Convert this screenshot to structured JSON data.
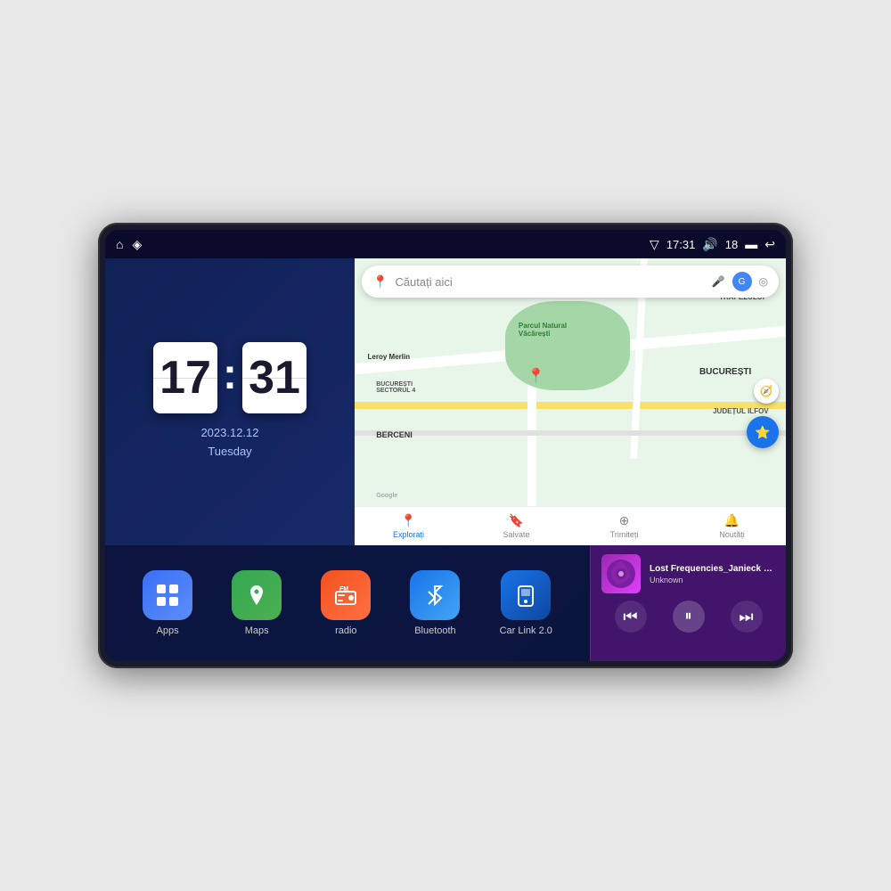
{
  "device": {
    "status_bar": {
      "signal_icon": "▽",
      "time": "17:31",
      "volume_icon": "🔊",
      "battery_level": "18",
      "battery_icon": "▬",
      "back_icon": "↩",
      "home_icon": "⌂",
      "nav_icon": "◈"
    },
    "clock": {
      "hours": "17",
      "minutes": "31",
      "date": "2023.12.12",
      "day": "Tuesday"
    },
    "map": {
      "search_placeholder": "Căutați aici",
      "nav_items": [
        {
          "label": "Explorați",
          "icon": "📍",
          "active": true
        },
        {
          "label": "Salvate",
          "icon": "🔖",
          "active": false
        },
        {
          "label": "Trimiteți",
          "icon": "⊕",
          "active": false
        },
        {
          "label": "Noutăți",
          "icon": "🔔",
          "active": false
        }
      ],
      "labels": [
        "TRAPEZULUI",
        "BUCUREȘTI",
        "JUDEȚUL ILFOV",
        "BERCENI",
        "Parcul Natural Văcărești",
        "Leroy Merlin",
        "BUCUREȘTI\nSECTORUL 4",
        "Google"
      ]
    },
    "apps": [
      {
        "id": "apps",
        "label": "Apps",
        "icon": "⊞",
        "color_class": "apps-icon"
      },
      {
        "id": "maps",
        "label": "Maps",
        "icon": "📍",
        "color_class": "maps-icon"
      },
      {
        "id": "radio",
        "label": "radio",
        "icon": "📻",
        "color_class": "radio-icon"
      },
      {
        "id": "bluetooth",
        "label": "Bluetooth",
        "icon": "⚡",
        "color_class": "bt-icon"
      },
      {
        "id": "carlink",
        "label": "Car Link 2.0",
        "icon": "📱",
        "color_class": "carlink-icon"
      }
    ],
    "music": {
      "title": "Lost Frequencies_Janieck Devy-...",
      "artist": "Unknown",
      "prev_icon": "⏮",
      "play_icon": "⏸",
      "next_icon": "⏭"
    }
  }
}
